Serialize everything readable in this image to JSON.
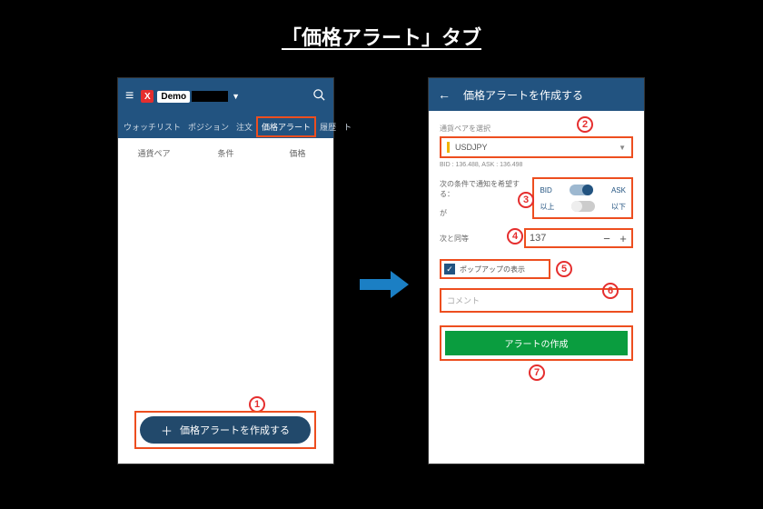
{
  "title": "「価格アラート」タブ",
  "leftPhone": {
    "demoBadge": "Demo",
    "tabs": [
      "ウォッチリスト",
      "ポジション",
      "注文",
      "価格アラート",
      "履歴",
      "ト"
    ],
    "listHeaders": [
      "通貨ペア",
      "条件",
      "価格"
    ],
    "createBtn": "価格アラートを作成する"
  },
  "rightPhone": {
    "headerTitle": "価格アラートを作成する",
    "pairLabel": "通貨ペアを選択",
    "pair": "USDJPY",
    "bidAsk": "BID : 136.488, ASK : 136.498",
    "condLabel": "次の条件で通知を希望する：",
    "gaLabel": "が",
    "bid": "BID",
    "ask": "ASK",
    "ijou": "以上",
    "ika": "以下",
    "equalLabel": "次と同等",
    "equalValue": "137",
    "popupLabel": "ポップアップの表示",
    "commentPlaceholder": "コメント",
    "submit": "アラートの作成"
  },
  "nums": {
    "n1": "1",
    "n2": "2",
    "n3": "3",
    "n4": "4",
    "n5": "5",
    "n6": "6",
    "n7": "7"
  }
}
